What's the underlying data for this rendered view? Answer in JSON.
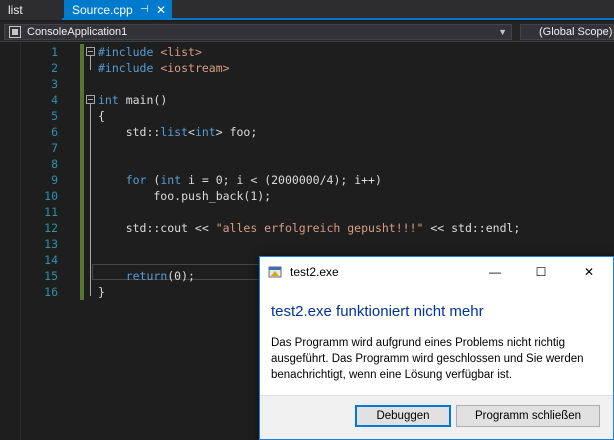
{
  "tabs": {
    "list_label": "list",
    "active_label": "Source.cpp",
    "pin_glyph": "⊣",
    "close_glyph": "✕"
  },
  "navbar": {
    "project": "ConsoleApplication1",
    "scope": "(Global Scope)"
  },
  "editor": {
    "line_numbers": [
      "1",
      "2",
      "3",
      "4",
      "5",
      "6",
      "7",
      "8",
      "9",
      "10",
      "11",
      "12",
      "13",
      "14",
      "15",
      "16"
    ]
  },
  "dialog": {
    "title": "test2.exe",
    "heading": "test2.exe funktioniert nicht mehr",
    "message": "Das Programm wird aufgrund eines Problems nicht richtig ausgeführt. Das Programm wird geschlossen und Sie werden benachrichtigt, wenn eine Lösung verfügbar ist.",
    "debug_label": "Debuggen",
    "close_program_label": "Programm schließen",
    "minimize_glyph": "—",
    "maximize_glyph": "☐",
    "close_glyph": "✕"
  },
  "colors": {
    "accent": "#007acc",
    "keyword": "#569cd6",
    "string": "#d69d85",
    "line_number": "#2b91af",
    "dialog_heading": "#003399"
  }
}
